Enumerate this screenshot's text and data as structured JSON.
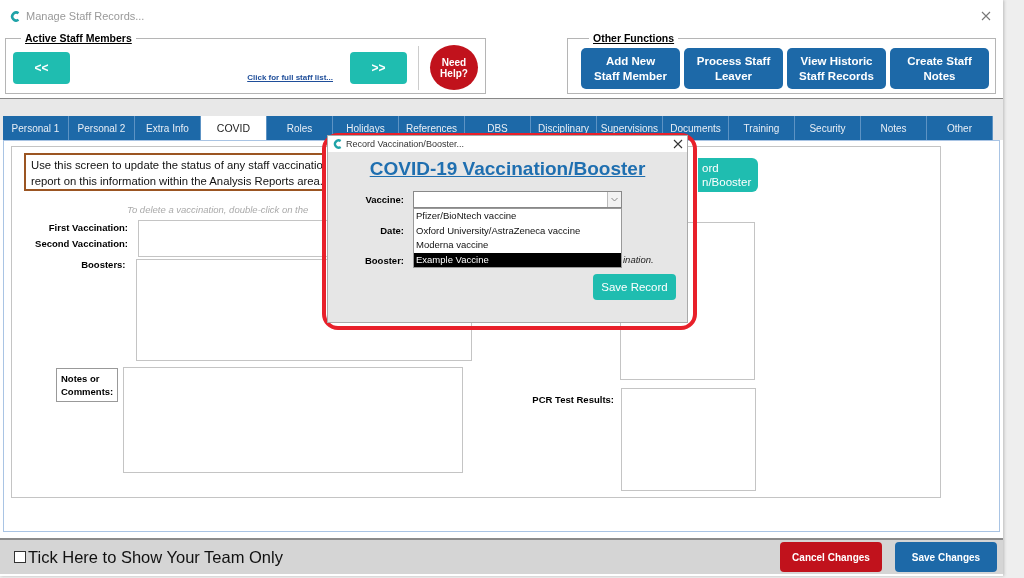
{
  "window": {
    "title": "Manage Staff Records..."
  },
  "active_staff": {
    "legend": "Active Staff Members",
    "prev_button": "<<",
    "next_button": ">>",
    "full_list_link": "Click for full staff list..."
  },
  "help_button": {
    "lines": [
      "Need",
      "Help?"
    ]
  },
  "other_functions": {
    "legend": "Other Functions",
    "buttons": [
      {
        "lines": [
          "Add New",
          "Staff Member"
        ]
      },
      {
        "lines": [
          "Process Staff",
          "Leaver"
        ]
      },
      {
        "lines": [
          "View Historic",
          "Staff Records"
        ]
      },
      {
        "lines": [
          "Create Staff",
          "Notes"
        ]
      }
    ]
  },
  "tabs": [
    {
      "label": "Personal 1",
      "selected": false
    },
    {
      "label": "Personal 2",
      "selected": false
    },
    {
      "label": "Extra Info",
      "selected": false
    },
    {
      "label": "COVID",
      "selected": true
    },
    {
      "label": "Roles",
      "selected": false
    },
    {
      "label": "Holidays",
      "selected": false
    },
    {
      "label": "References",
      "selected": false
    },
    {
      "label": "DBS",
      "selected": false
    },
    {
      "label": "Disciplinary",
      "selected": false
    },
    {
      "label": "Supervisions",
      "selected": false
    },
    {
      "label": "Documents",
      "selected": false
    },
    {
      "label": "Training",
      "selected": false
    },
    {
      "label": "Security",
      "selected": false
    },
    {
      "label": "Notes",
      "selected": false
    },
    {
      "label": "Other",
      "selected": false
    }
  ],
  "covid_form": {
    "info_lines": [
      "Use this screen to update the status of any staff vaccinatio",
      "report on this information within the Analysis Reports area."
    ],
    "hint": "To delete a vaccination, double-click on the",
    "record_button_lines": [
      "ord",
      "n/Booster"
    ],
    "first_vaccination_label": "First Vaccination:",
    "second_vaccination_label": "Second Vaccination:",
    "boosters_label": "Boosters:",
    "notes_label_lines": [
      "Notes or",
      "Comments:"
    ],
    "pcr_label": "PCR Test Results:"
  },
  "dialog": {
    "title": "Record Vaccination/Booster...",
    "heading": "COVID-19 Vaccination/Booster",
    "vaccine_label": "Vaccine:",
    "date_label": "Date:",
    "booster_label": "Booster:",
    "hint_tail": "ination.",
    "options": [
      {
        "label": "Pfizer/BioNtech vaccine",
        "selected": false
      },
      {
        "label": "Oxford University/AstraZeneca vaccine",
        "selected": false
      },
      {
        "label": "Moderna vaccine",
        "selected": false
      },
      {
        "label": "Example Vaccine",
        "selected": true
      }
    ],
    "save_button": "Save Record"
  },
  "footer": {
    "team_only": {
      "label": "Tick Here to Show Your Team Only",
      "checked": false
    },
    "cancel_button": "Cancel Changes",
    "save_button": "Save Changes"
  }
}
